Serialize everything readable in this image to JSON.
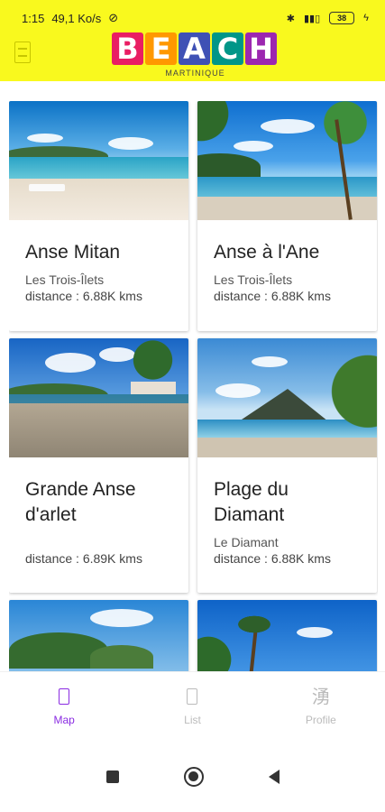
{
  "status_bar": {
    "time": "1:15",
    "speed": "49,1 Ko/s",
    "battery": "38"
  },
  "header": {
    "logo_letters": [
      "B",
      "E",
      "A",
      "C",
      "H"
    ],
    "logo_colors": [
      "#e91e63",
      "#ff9800",
      "#3f51b5",
      "#009688",
      "#9c27b0"
    ],
    "logo_subtitle": "MARTINIQUE",
    "background_color": "#f9f91e"
  },
  "beaches": [
    {
      "name": "Anse Mitan",
      "town": "Les Trois-Îlets",
      "distance": "distance :  6.88K kms"
    },
    {
      "name": "Anse à l'Ane",
      "town": "Les Trois-Îlets",
      "distance": "distance :  6.88K kms"
    },
    {
      "name": "Grande Anse d'arlet",
      "town": "",
      "distance": "distance :  6.89K kms"
    },
    {
      "name": "Plage du Diamant",
      "town": "Le Diamant",
      "distance": "distance :  6.88K kms"
    }
  ],
  "bottom_nav": {
    "items": [
      {
        "label": "Map",
        "icon": "map-icon",
        "active": true
      },
      {
        "label": "List",
        "icon": "list-icon",
        "active": false
      },
      {
        "label": "Profile",
        "icon": "profile-icon",
        "active": false
      }
    ],
    "active_color": "#8a2be2"
  }
}
